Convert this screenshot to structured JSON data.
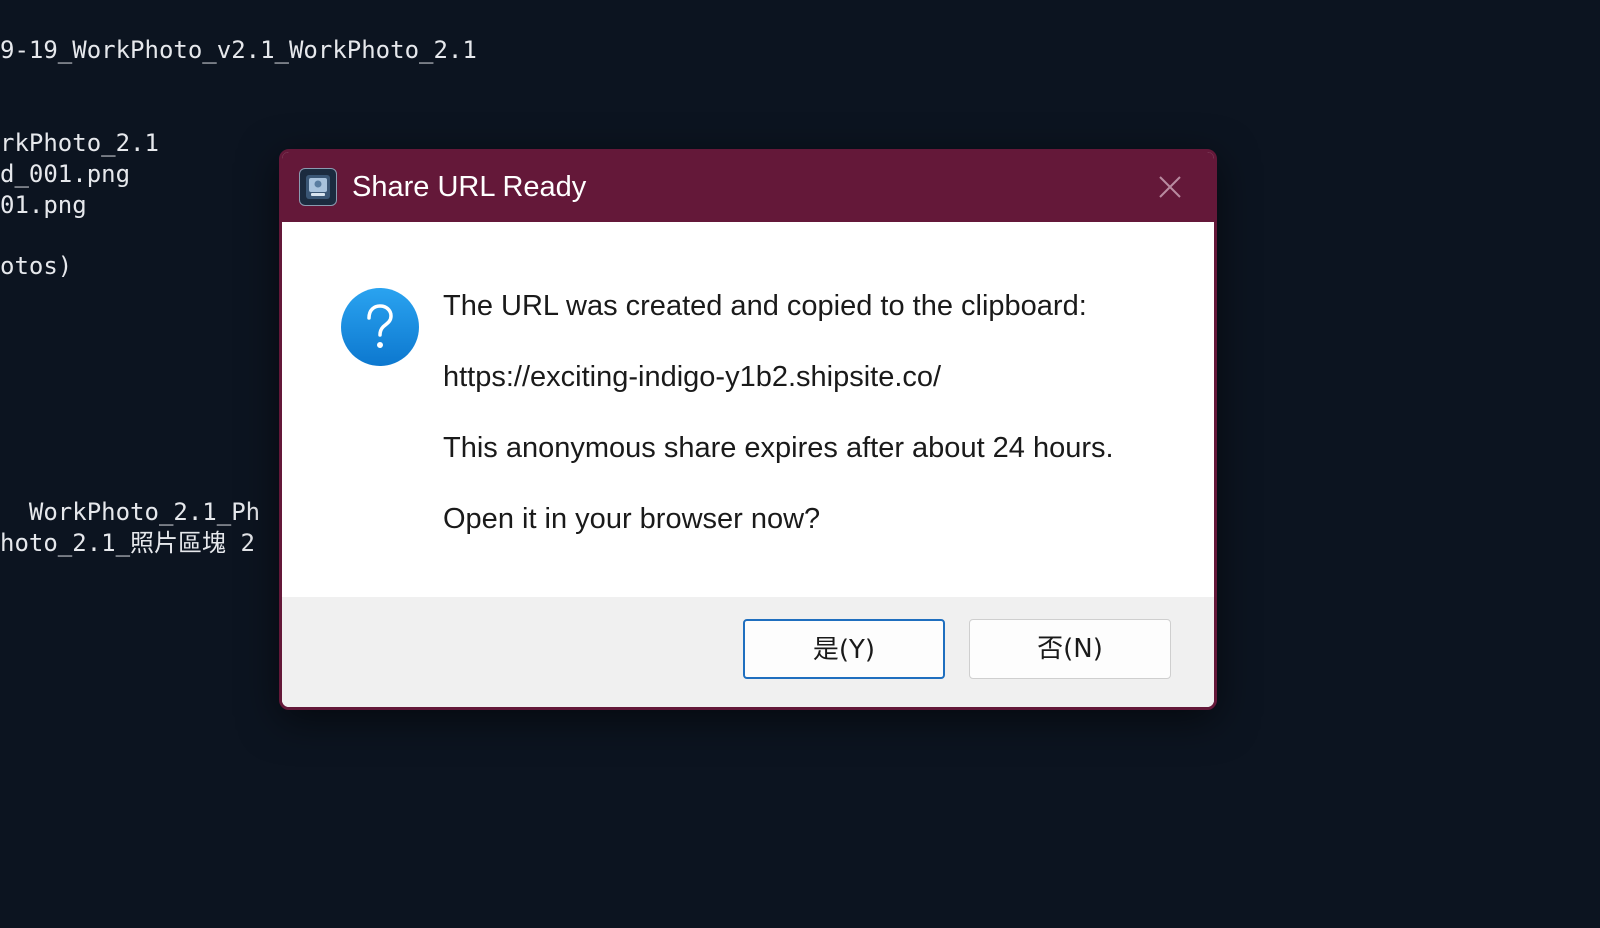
{
  "terminal": {
    "lines": [
      "9-19_WorkPhoto_v2.1_WorkPhoto_2.1",
      "rkPhoto_2.1",
      "d_001.png",
      "01.png",
      "otos)",
      "  WorkPhoto_2.1_Ph",
      "hoto_2.1_照片區塊 2"
    ]
  },
  "dialog": {
    "title": "Share URL Ready",
    "app_icon": "app-icon",
    "close_icon": "close-icon",
    "message_icon": "question-icon",
    "message_lines": [
      "The URL was created and copied to the clipboard:",
      "https://exciting-indigo-y1b2.shipsite.co/",
      "This anonymous share expires after about 24 hours.",
      "Open it in your browser now?"
    ],
    "buttons": {
      "yes_label": "是(Y)",
      "no_label": "否(N)"
    }
  },
  "colors": {
    "titlebar": "#641839",
    "terminal_bg": "#0c1420",
    "question_icon": "#1a8fe0",
    "default_button_border": "#1f6fbf"
  }
}
